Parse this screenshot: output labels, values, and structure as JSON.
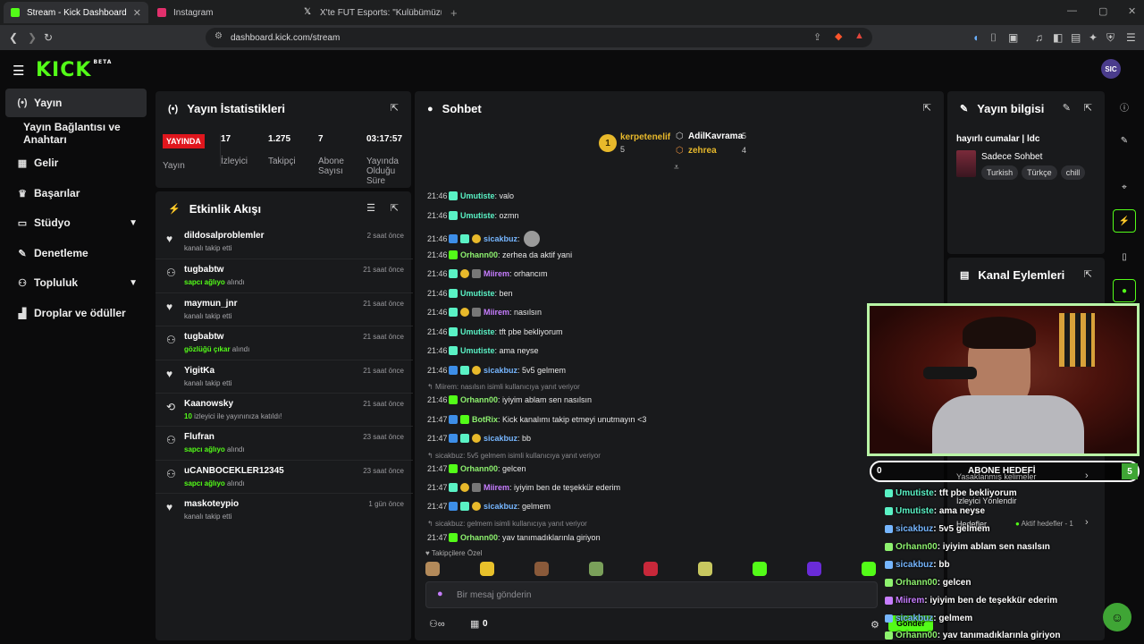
{
  "browser": {
    "tabs": [
      {
        "title": "Stream - Kick Dashboard",
        "color": "#53fc18"
      },
      {
        "title": "Instagram",
        "color": "#e1306c"
      },
      {
        "title": "X'te FUT Esports: \"Kulübümüzün yen",
        "color": "#ffffff"
      }
    ],
    "new_tab": "+",
    "url": "dashboard.kick.com/stream"
  },
  "app": {
    "logo": "KICK",
    "logo_badge": "BETA",
    "avatar": "SIC"
  },
  "sidebar": {
    "items": [
      {
        "label": "Yayın",
        "icon": "broadcast-icon"
      },
      {
        "label": "Yayın Bağlantısı ve Anahtarı",
        "icon": ""
      },
      {
        "label": "Gelir",
        "icon": "chart-icon"
      },
      {
        "label": "Başarılar",
        "icon": "trophy-icon"
      },
      {
        "label": "Stüdyo",
        "icon": "studio-icon"
      },
      {
        "label": "Denetleme",
        "icon": "wrench-icon"
      },
      {
        "label": "Topluluk",
        "icon": "community-icon"
      },
      {
        "label": "Droplar ve ödüller",
        "icon": "gift-icon"
      }
    ]
  },
  "stats": {
    "title": "Yayın İstatistikleri",
    "live": "YAYINDA",
    "live_label": "Yayın",
    "viewers": "17",
    "viewers_label": "İzleyici",
    "followers": "1.275",
    "followers_label": "Takipçi",
    "subs": "7",
    "subs_label": "Abone Sayısı",
    "duration": "03:17:57",
    "duration_label": "Yayında Olduğu Süre"
  },
  "feed": {
    "title": "Etkinlik Akışı",
    "events": [
      {
        "name": "dildosalproblemler",
        "pre": "",
        "hl": "",
        "post": "kanalı takip etti",
        "time": "2 saat önce",
        "icon": "heart"
      },
      {
        "name": "tugbabtw",
        "pre": "",
        "hl": "sapcı ağlıyo",
        "post": " alındı",
        "time": "21 saat önce",
        "icon": "reward"
      },
      {
        "name": "maymun_jnr",
        "pre": "",
        "hl": "",
        "post": "kanalı takip etti",
        "time": "21 saat önce",
        "icon": "heart"
      },
      {
        "name": "tugbabtw",
        "pre": "",
        "hl": "gözlüğü çıkar",
        "post": " alındı",
        "time": "21 saat önce",
        "icon": "reward"
      },
      {
        "name": "YigitKa",
        "pre": "",
        "hl": "",
        "post": "kanalı takip etti",
        "time": "21 saat önce",
        "icon": "heart"
      },
      {
        "name": "Kaanowsky",
        "pre": "",
        "hl": "10",
        "post": " izleyici ile yayınınıza katıldı!",
        "time": "21 saat önce",
        "icon": "host"
      },
      {
        "name": "Flufran",
        "pre": "",
        "hl": "sapcı ağlıyo",
        "post": " alındı",
        "time": "23 saat önce",
        "icon": "reward"
      },
      {
        "name": "uCANBOCEKLER12345",
        "pre": "",
        "hl": "sapcı ağlıyo",
        "post": " alındı",
        "time": "23 saat önce",
        "icon": "reward"
      },
      {
        "name": "maskoteypio",
        "pre": "",
        "hl": "",
        "post": "kanalı takip etti",
        "time": "1 gün önce",
        "icon": "heart"
      }
    ]
  },
  "chat": {
    "title": "Sohbet",
    "top": [
      {
        "rank": "1",
        "name": "kerpetenelif",
        "count": "5"
      },
      {
        "rank": "2",
        "name": "AdilKavrama",
        "count": "5"
      },
      {
        "rank": "3",
        "name": "zehrea",
        "count": "4"
      }
    ],
    "messages": [
      {
        "time": "21:46",
        "user": "Umutiste",
        "color": "#5af2c5",
        "text": ": valo",
        "badges": [
          "sub"
        ]
      },
      {
        "time": "21:46",
        "user": "Umutiste",
        "color": "#5af2c5",
        "text": ": ozmn",
        "badges": [
          "sub"
        ]
      },
      {
        "time": "21:46",
        "user": "sicakbuz",
        "color": "#76b6ff",
        "text": ":",
        "badges": [
          "mod",
          "sub",
          "og"
        ]
      },
      {
        "time": "21:46",
        "user": "Orhann00",
        "color": "#8ef26f",
        "text": ": zerhea da aktif yani",
        "badges": [
          "gift"
        ]
      },
      {
        "time": "21:46",
        "user": "Miirem",
        "color": "#c77dff",
        "text": ": orhancım",
        "badges": [
          "sub",
          "og",
          "vip"
        ]
      },
      {
        "time": "21:46",
        "user": "Umutiste",
        "color": "#5af2c5",
        "text": ": ben",
        "badges": [
          "sub"
        ]
      },
      {
        "time": "21:46",
        "user": "Miirem",
        "color": "#c77dff",
        "text": ": nasılsın",
        "badges": [
          "sub",
          "og",
          "vip"
        ]
      },
      {
        "time": "21:46",
        "user": "Umutiste",
        "color": "#5af2c5",
        "text": ": tft pbe bekliyorum",
        "badges": [
          "sub"
        ]
      },
      {
        "time": "21:46",
        "user": "Umutiste",
        "color": "#5af2c5",
        "text": ": ama neyse",
        "badges": [
          "sub"
        ]
      },
      {
        "time": "21:46",
        "user": "sicakbuz",
        "color": "#76b6ff",
        "text": ": 5v5 gelmem",
        "badges": [
          "mod",
          "sub",
          "og"
        ]
      },
      {
        "reply": "Miirem: nasılsın isimli kullanıcıya yanıt veriyor"
      },
      {
        "time": "21:46",
        "user": "Orhann00",
        "color": "#8ef26f",
        "text": ": iyiyim ablam sen nasılsın",
        "badges": [
          "gift"
        ]
      },
      {
        "time": "21:47",
        "user": "BotRix",
        "color": "#8ef26f",
        "text": ": Kick kanalımı takip etmeyi unutmayın <3",
        "badges": [
          "mod",
          "bot"
        ]
      },
      {
        "time": "21:47",
        "user": "sicakbuz",
        "color": "#76b6ff",
        "text": ": bb",
        "badges": [
          "mod",
          "sub",
          "og"
        ]
      },
      {
        "reply": "sicakbuz: 5v5 gelmem isimli kullanıcıya yanıt veriyor"
      },
      {
        "time": "21:47",
        "user": "Orhann00",
        "color": "#8ef26f",
        "text": ": gelcen",
        "badges": [
          "gift"
        ]
      },
      {
        "time": "21:47",
        "user": "Miirem",
        "color": "#c77dff",
        "text": ": iyiyim ben de teşekkür ederim",
        "badges": [
          "sub",
          "og",
          "vip"
        ]
      },
      {
        "time": "21:47",
        "user": "sicakbuz",
        "color": "#76b6ff",
        "text": ": gelmem",
        "badges": [
          "mod",
          "sub",
          "og"
        ]
      },
      {
        "reply": "sicakbuz: gelmem isimli kullanıcıya yanıt veriyor"
      },
      {
        "time": "21:47",
        "user": "Orhann00",
        "color": "#8ef26f",
        "text": ": yav tanımadıklarınla giriyon",
        "badges": [
          "gift"
        ]
      }
    ],
    "follower_only": "Takipçilere Özel",
    "input_placeholder": "Bir mesaj gönderin",
    "points": "0",
    "send": "Gönder"
  },
  "info": {
    "title": "Yayın bilgisi",
    "stream_title": "hayırlı cumalar | ldc",
    "category": "Sadece Sohbet",
    "tags": [
      "Turkish",
      "Türkçe",
      "chill"
    ]
  },
  "actions": {
    "title": "Kanal Eylemleri"
  },
  "overlay": {
    "goal_left": "0",
    "goal_title": "ABONE HEDEFİ",
    "goal_right": "5",
    "peek_1": "Yasaklanmış kelimeler",
    "peek_2": "İzleyici Yönlendir",
    "peek_3": "Hedefler",
    "peek_4": "Aktif hedefler - 1",
    "lines": [
      {
        "user": "Umutiste",
        "color": "#5af2c5",
        "text": ": tft pbe bekliyorum"
      },
      {
        "user": "Umutiste",
        "color": "#5af2c5",
        "text": ": ama neyse"
      },
      {
        "user": "sicakbuz",
        "color": "#76b6ff",
        "text": ": 5v5 gelmem"
      },
      {
        "user": "Orhann00",
        "color": "#8ef26f",
        "text": ": iyiyim ablam sen nasılsın"
      },
      {
        "user": "sicakbuz",
        "color": "#76b6ff",
        "text": ": bb"
      },
      {
        "user": "Orhann00",
        "color": "#8ef26f",
        "text": ": gelcen"
      },
      {
        "user": "Miirem",
        "color": "#c77dff",
        "text": ": iyiyim ben de teşekkür ederim"
      },
      {
        "user": "sicakbuz",
        "color": "#76b6ff",
        "text": ": gelmem"
      },
      {
        "user": "Orhann00",
        "color": "#8ef26f",
        "text": ": yav tanımadıklarınla giriyon"
      }
    ]
  },
  "colors": {
    "brand": "#53fc18",
    "live": "#e0161d",
    "panel": "#191a1c"
  }
}
